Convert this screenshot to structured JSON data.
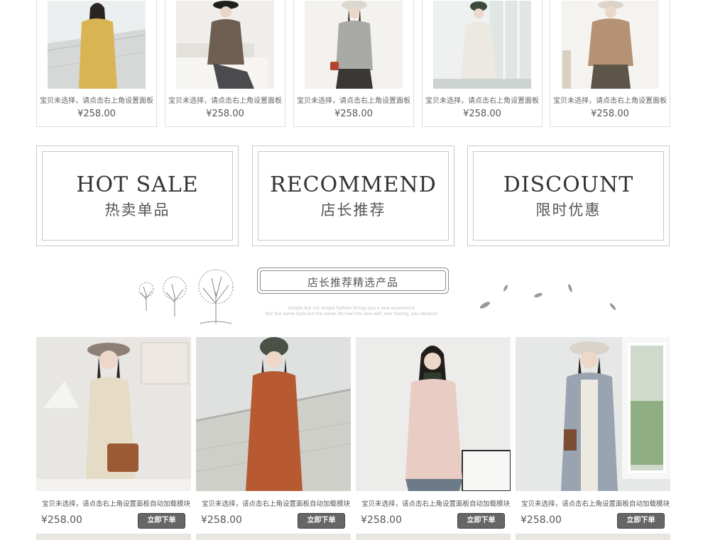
{
  "top_products": [
    {
      "caption": "宝贝未选择，请点击右上角设置面板",
      "price": "¥258.00",
      "bg": "#eceff0",
      "coat": "#d9b452"
    },
    {
      "caption": "宝贝未选择，请点击右上角设置面板",
      "price": "¥258.00",
      "bg": "#f0eeeb",
      "coat": "#6e5f52"
    },
    {
      "caption": "宝贝未选择，请点击右上角设置面板",
      "price": "¥258.00",
      "bg": "#f4f2ef",
      "coat": "#a9a9a6"
    },
    {
      "caption": "宝贝未选择，请点击右上角设置面板",
      "price": "¥258.00",
      "bg": "#eef1f0",
      "coat": "#ece8e2"
    },
    {
      "caption": "宝贝未选择，请点击右上角设置面板",
      "price": "¥258.00",
      "bg": "#f5f3f0",
      "coat": "#b59273"
    }
  ],
  "categories": [
    {
      "en": "HOT SALE",
      "cn": "热卖单品"
    },
    {
      "en": "RECOMMEND",
      "cn": "店长推荐"
    },
    {
      "en": "DISCOUNT",
      "cn": "限时优惠"
    }
  ],
  "section": {
    "title": "店长推荐精选产品",
    "sub1": "Simple but not simple fashion brings you a new experience",
    "sub2": "Not the same style but the same life Feel the new self, new feeling, you deserve"
  },
  "products": [
    {
      "caption": "宝贝未选择，请点击右上角设置面板自动加载模块",
      "price": "¥258.00",
      "buy": "立即下单",
      "bg": "#e7e6e3",
      "coat": "#e6dcc6"
    },
    {
      "caption": "宝贝未选择，请点击右上角设置面板自动加载模块",
      "price": "¥258.00",
      "buy": "立即下单",
      "bg": "#dfe1e0",
      "coat": "#b75a32"
    },
    {
      "caption": "宝贝未选择，请点击右上角设置面板自动加载模块",
      "price": "¥258.00",
      "buy": "立即下单",
      "bg": "#ececea",
      "coat": "#e9cdc4"
    },
    {
      "caption": "宝贝未选择，请点击右上角设置面板自动加载模块",
      "price": "¥258.00",
      "buy": "立即下单",
      "bg": "#e5e8e7",
      "coat": "#9aa4b1"
    }
  ],
  "colors": {
    "border": "#dddddd",
    "button": "#666666",
    "text": "#555555"
  }
}
